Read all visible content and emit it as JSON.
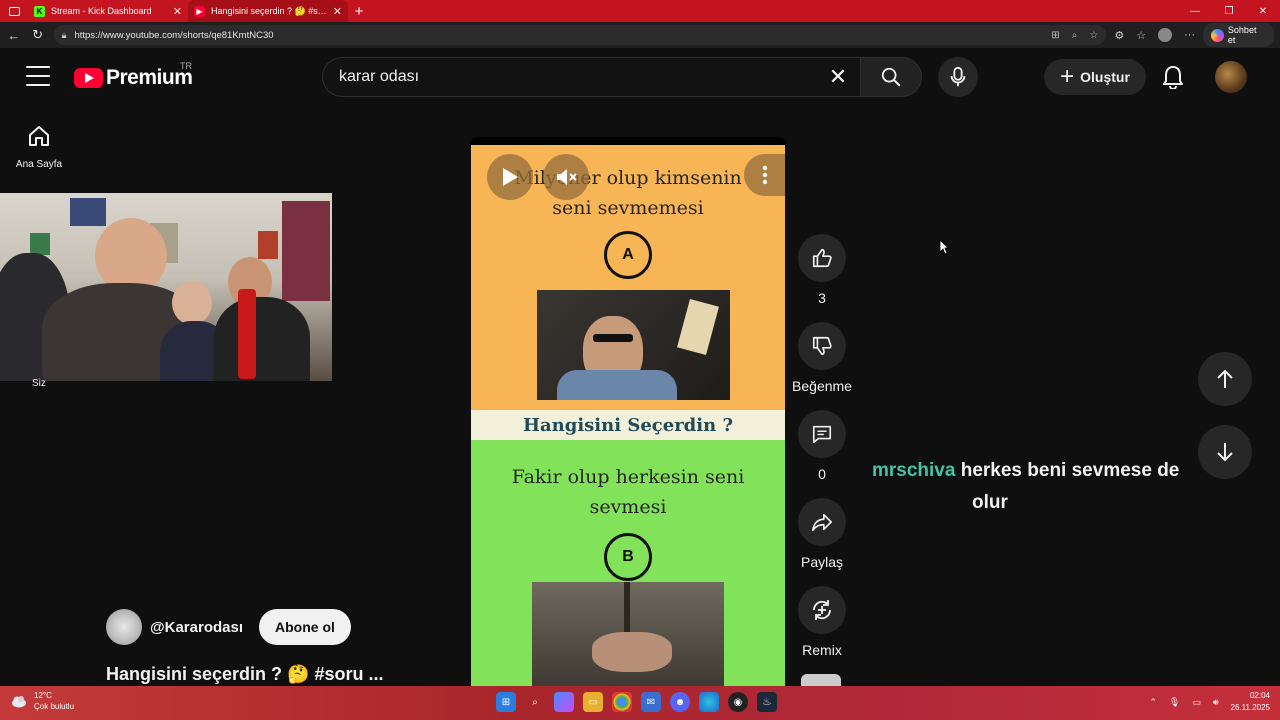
{
  "browser": {
    "tabs": [
      {
        "title": "Stream - Kick Dashboard",
        "active": false
      },
      {
        "title": "Hangisini seçerdin ? 🤔 #soru #e",
        "active": true
      }
    ],
    "url": "https://www.youtube.com/shorts/qe81KmtNC30",
    "copilot_label": "Sohbet et"
  },
  "header": {
    "logo_text": "Premium",
    "region": "TR",
    "search_value": "karar odası",
    "create_label": "Oluştur"
  },
  "sidebar": {
    "home_label": "Ana Sayfa"
  },
  "webcam": {
    "label": "Siz"
  },
  "short": {
    "option_a_text_line1": "Milyoner olup kimsenin",
    "option_a_text_line2": "seni sevmemesi",
    "option_a_letter": "A",
    "banner_text": "Hangisini Seçerdin ?",
    "option_b_text_line1": "Fakir olup herkesin seni",
    "option_b_text_line2": "sevmesi",
    "option_b_letter": "B"
  },
  "actions": {
    "like_count": "3",
    "dislike_label": "Beğenme",
    "comment_count": "0",
    "share_label": "Paylaş",
    "remix_label": "Remix"
  },
  "channel": {
    "handle": "@Kararodası",
    "subscribe_label": "Abone ol",
    "video_title": "Hangisini seçerdin ? 🤔 #soru ..."
  },
  "chat": {
    "username": "mrschiva",
    "message_line1": "herkes beni sevmese de",
    "message_line2": "olur"
  },
  "taskbar": {
    "temperature": "12°C",
    "weather": "Çok bulutlu",
    "time": "02:04",
    "date": "26.11.2025"
  },
  "colors": {
    "browser_red": "#c4141f",
    "youtube_red": "#ff0033",
    "chat_username": "#44c4a6",
    "option_a_bg": "#f7b556",
    "option_b_bg": "#82e25a"
  }
}
